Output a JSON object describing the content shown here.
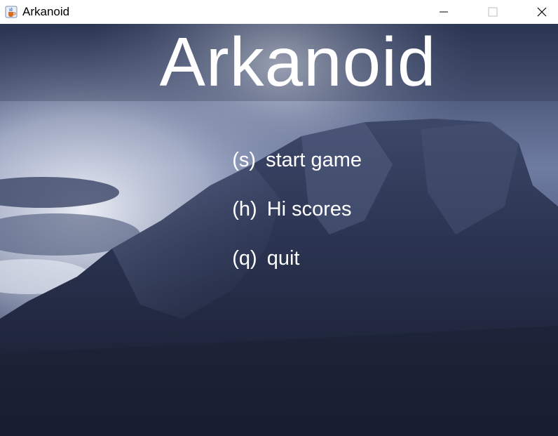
{
  "window": {
    "title": "Arkanoid",
    "app_icon": "java-cup-icon",
    "controls": [
      "minimize-icon",
      "maximize-icon",
      "close-icon"
    ]
  },
  "game": {
    "title": "Arkanoid",
    "background": "stormy-mountain-landscape",
    "menu": [
      {
        "key": "(s)",
        "label": "start game"
      },
      {
        "key": "(h)",
        "label": "Hi scores"
      },
      {
        "key": "(q)",
        "label": "quit"
      }
    ]
  },
  "colors": {
    "text": "#ffffff",
    "sky": "#5b6891",
    "mountain": "#1d2438"
  }
}
